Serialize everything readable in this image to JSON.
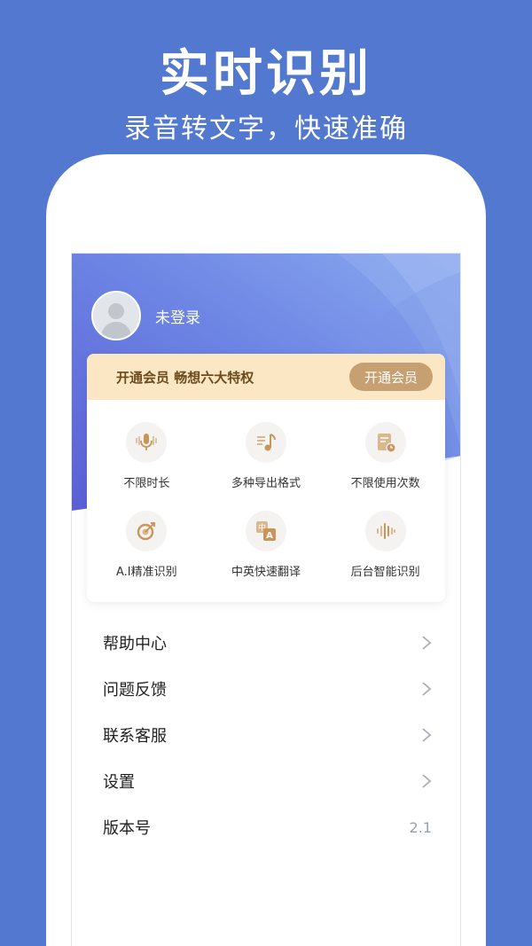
{
  "promo": {
    "title": "实时识别",
    "subtitle": "录音转文字，快速准确"
  },
  "user": {
    "login_status": "未登录"
  },
  "vip": {
    "banner_text": "开通会员 畅想六大特权",
    "button_label": "开通会员"
  },
  "features": [
    {
      "label": "不限时长",
      "icon": "microphone-icon"
    },
    {
      "label": "多种导出格式",
      "icon": "music-note-icon"
    },
    {
      "label": "不限使用次数",
      "icon": "document-clock-icon"
    },
    {
      "label": "A.I精准识别",
      "icon": "target-icon"
    },
    {
      "label": "中英快速翻译",
      "icon": "translate-icon"
    },
    {
      "label": "后台智能识别",
      "icon": "waveform-icon"
    }
  ],
  "menu": [
    {
      "label": "帮助中心"
    },
    {
      "label": "问题反馈"
    },
    {
      "label": "联系客服"
    },
    {
      "label": "设置"
    },
    {
      "label": "版本号",
      "value": "2.1"
    }
  ],
  "colors": {
    "background": "#5279cf",
    "header_gradient_start": "#5b63d8",
    "header_gradient_end": "#86a8ee",
    "vip_banner": "#fbe7c3",
    "vip_button": "#c7a071",
    "icon_gold": "#c8965a"
  }
}
